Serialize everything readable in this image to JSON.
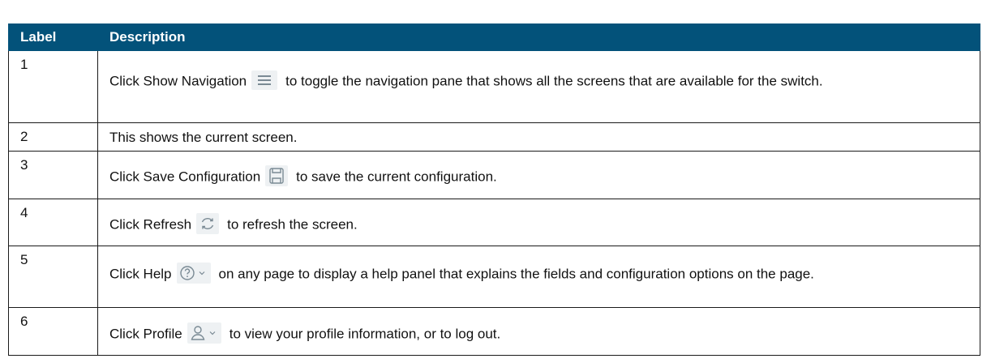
{
  "table": {
    "headers": [
      "Label",
      "Description"
    ],
    "rows": [
      {
        "label": "1",
        "before": "Click Show Navigation",
        "icon": "hamburger-menu-icon",
        "after": "to toggle the navigation pane that shows all the screens that are available for the switch."
      },
      {
        "label": "2",
        "text": "This shows the current screen."
      },
      {
        "label": "3",
        "before": "Click Save Configuration",
        "icon": "save-floppy-icon",
        "after": "to save the current configuration."
      },
      {
        "label": "4",
        "before": "Click Refresh",
        "icon": "refresh-icon",
        "after": "to refresh the screen."
      },
      {
        "label": "5",
        "before": "Click Help",
        "icon": "help-question-icon",
        "after": "on any page to display a help panel that explains the fields and configuration options on the page."
      },
      {
        "label": "6",
        "before": "Click Profile",
        "icon": "user-profile-icon",
        "after": "to view your profile information, or to log out."
      }
    ]
  },
  "colors": {
    "header_bg": "#03527a",
    "header_text": "#ffffff",
    "icon_stroke": "#7a8a94",
    "icon_bg": "#eef1f3"
  }
}
